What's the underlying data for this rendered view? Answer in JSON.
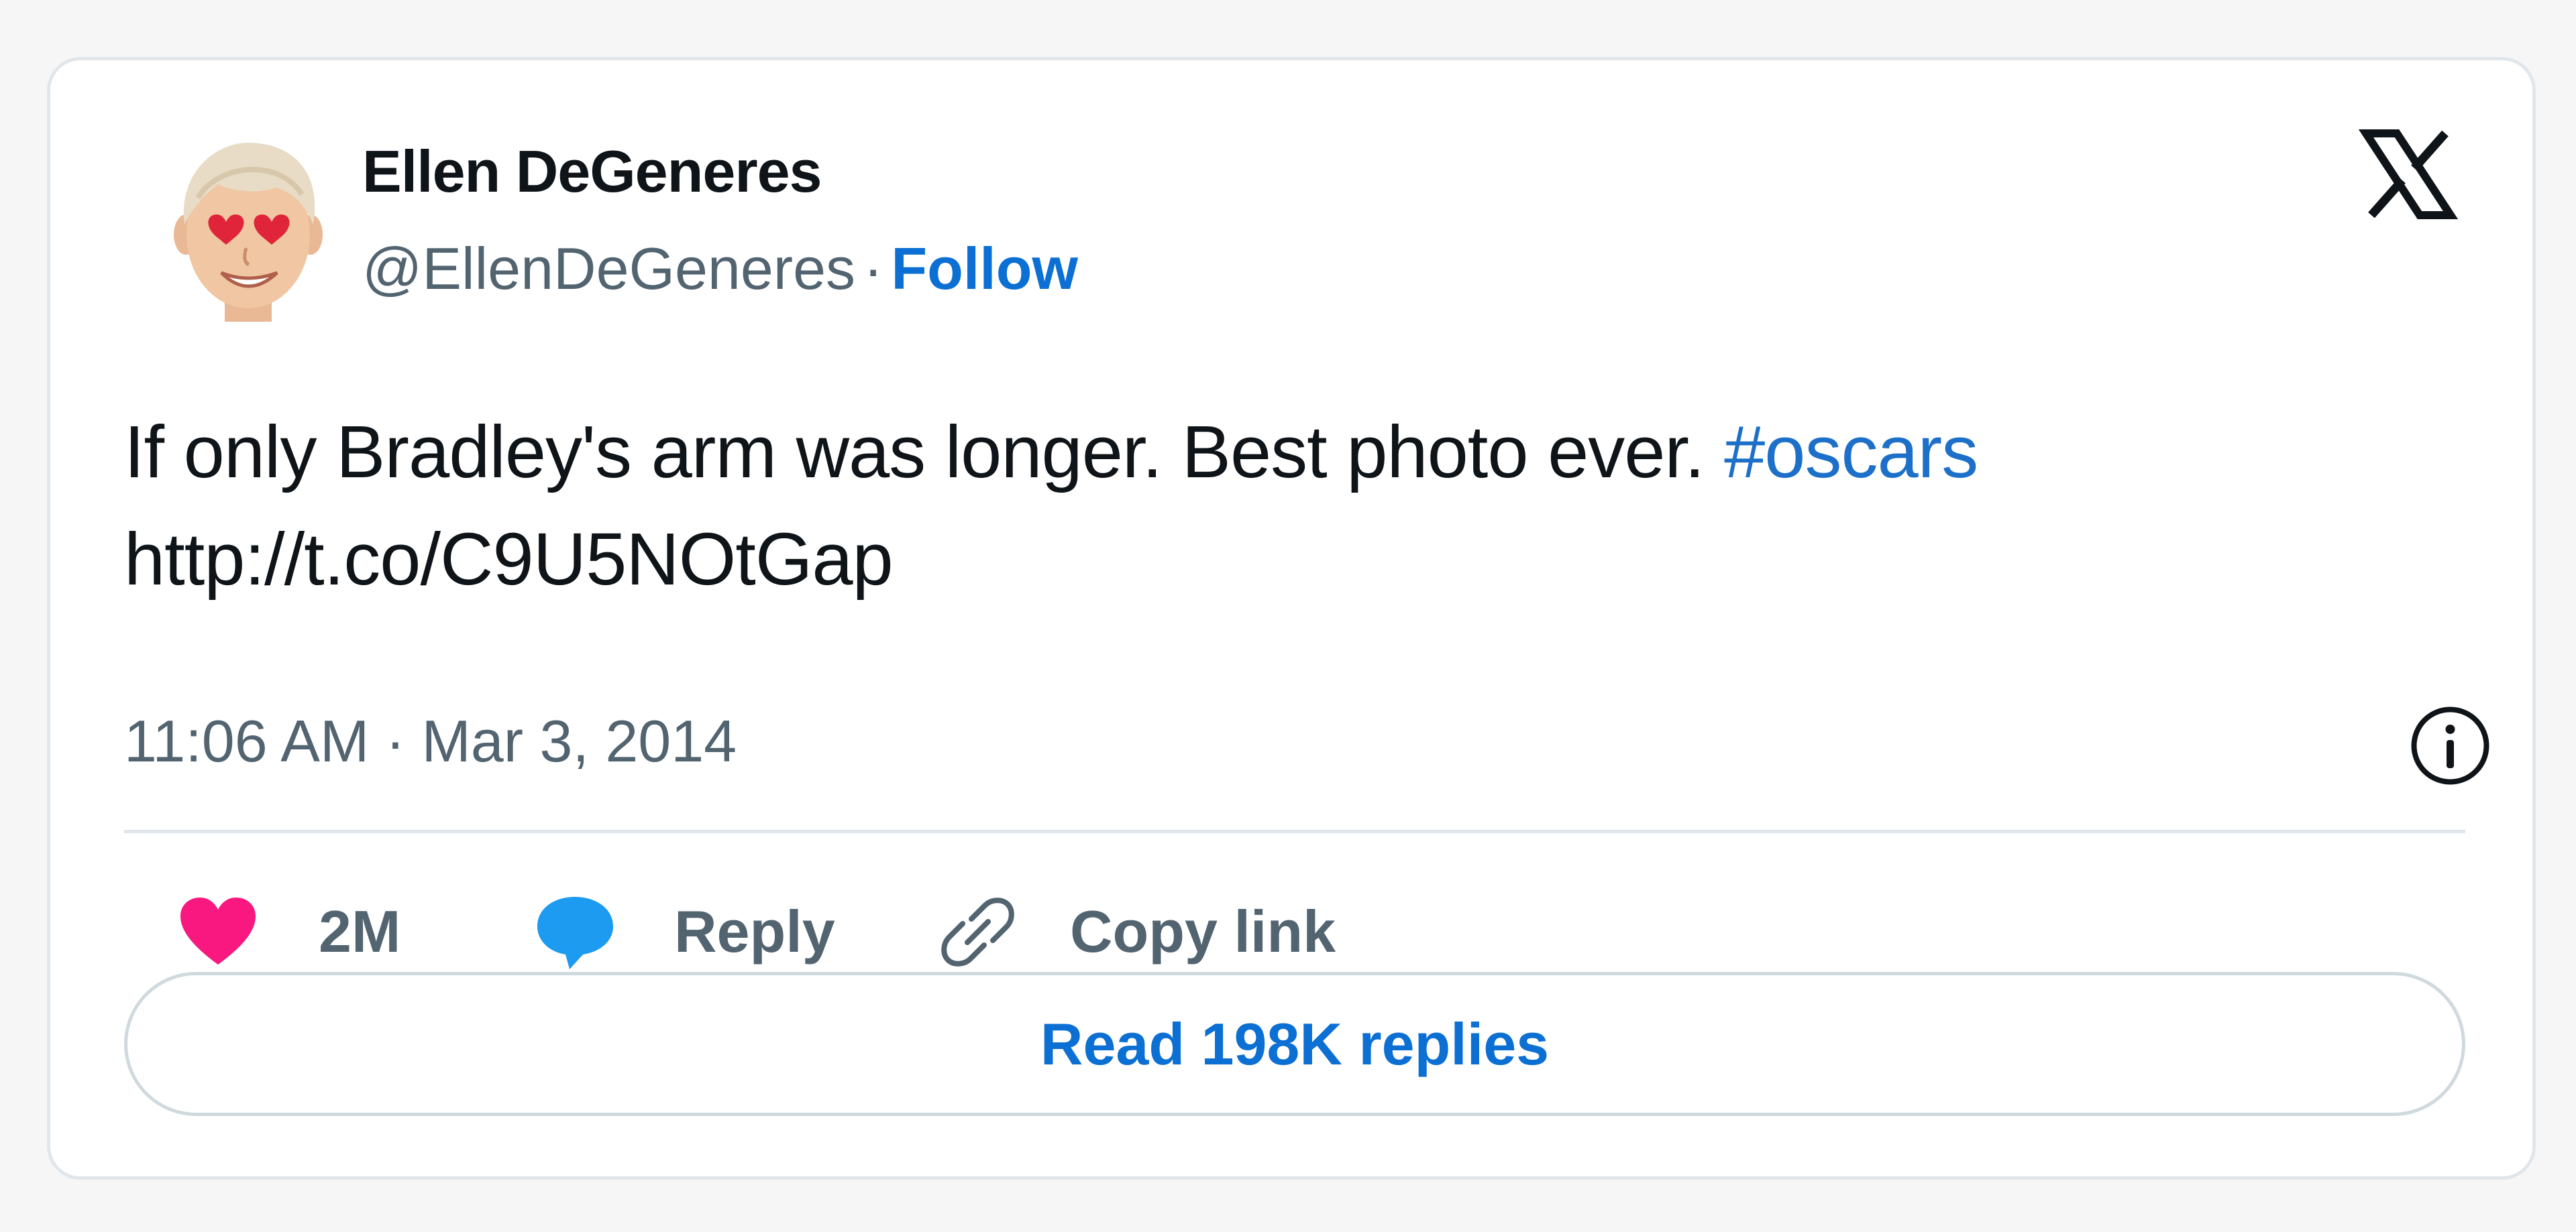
{
  "author": {
    "display_name": "Ellen DeGeneres",
    "handle": "@EllenDeGeneres",
    "separator": "·",
    "follow_label": "Follow"
  },
  "tweet": {
    "text": "If only Bradley's arm was longer. Best photo ever.",
    "hashtag": "#oscars",
    "link": "http://t.co/C9U5NOtGap",
    "time": "11:06 AM",
    "separator": "·",
    "date": "Mar 3, 2014"
  },
  "actions": {
    "like_count": "2M",
    "reply_label": "Reply",
    "copy_link_label": "Copy link"
  },
  "read_replies_label": "Read 198K replies",
  "icons": {
    "brand": "x-logo-icon",
    "info": "info-icon",
    "like": "heart-icon",
    "reply": "speech-bubble-icon",
    "copy": "link-icon"
  },
  "colors": {
    "accent_blue": "#0b6fd3",
    "hashtag_blue": "#1d70c9",
    "heart_pink": "#f91880",
    "reply_blue": "#1d9bf0",
    "text_primary": "#0f1419",
    "text_secondary": "#536471"
  }
}
